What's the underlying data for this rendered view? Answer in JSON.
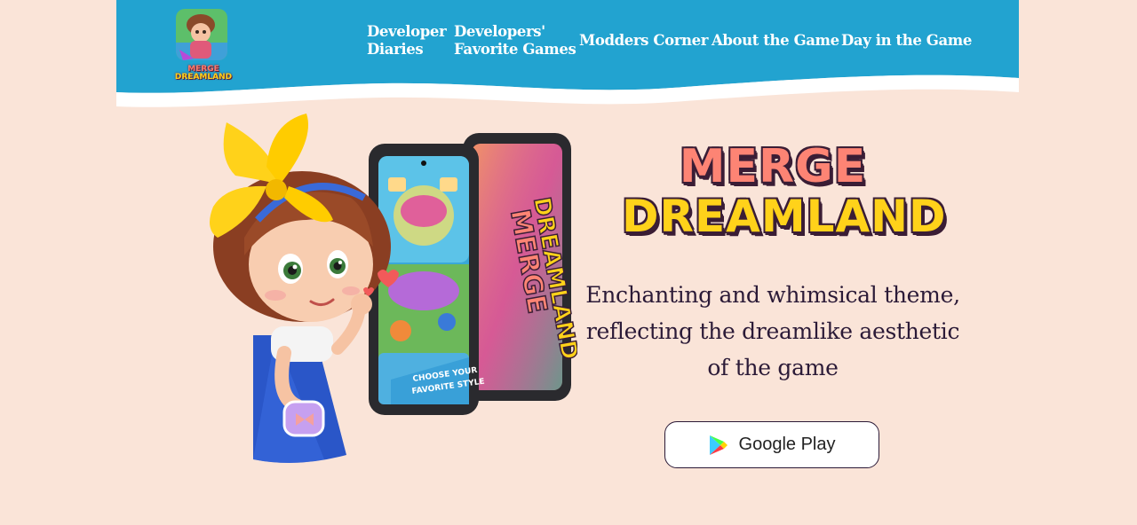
{
  "header": {
    "logo_text": [
      "MERGE",
      "DREAMLAND"
    ],
    "nav": [
      {
        "lines": [
          "Developer",
          "Diaries"
        ]
      },
      {
        "lines": [
          "Developers'",
          "Favorite Games"
        ]
      },
      {
        "label": "Modders Corner"
      },
      {
        "label": "About the Game"
      },
      {
        "label": "Day in the Game"
      }
    ]
  },
  "hero": {
    "title_line1": "MERGE",
    "title_line2": "DREAMLAND",
    "tagline": "Enchanting and whimsical theme, reflecting the dreamlike aesthetic of the game",
    "phone_banner_lines": [
      "CHOOSE YOUR",
      "FAVORITE STYLE"
    ],
    "phone2_text": [
      "MERGE",
      "DREAMLAND"
    ],
    "store_button_label": "Google Play",
    "store_icon": "google-play-icon"
  },
  "colors": {
    "header_blue": "#22a3d0",
    "background": "#fae4d8",
    "title_coral": "#fd8474",
    "title_yellow": "#ffd21a",
    "text_dark": "#2b1a37"
  }
}
